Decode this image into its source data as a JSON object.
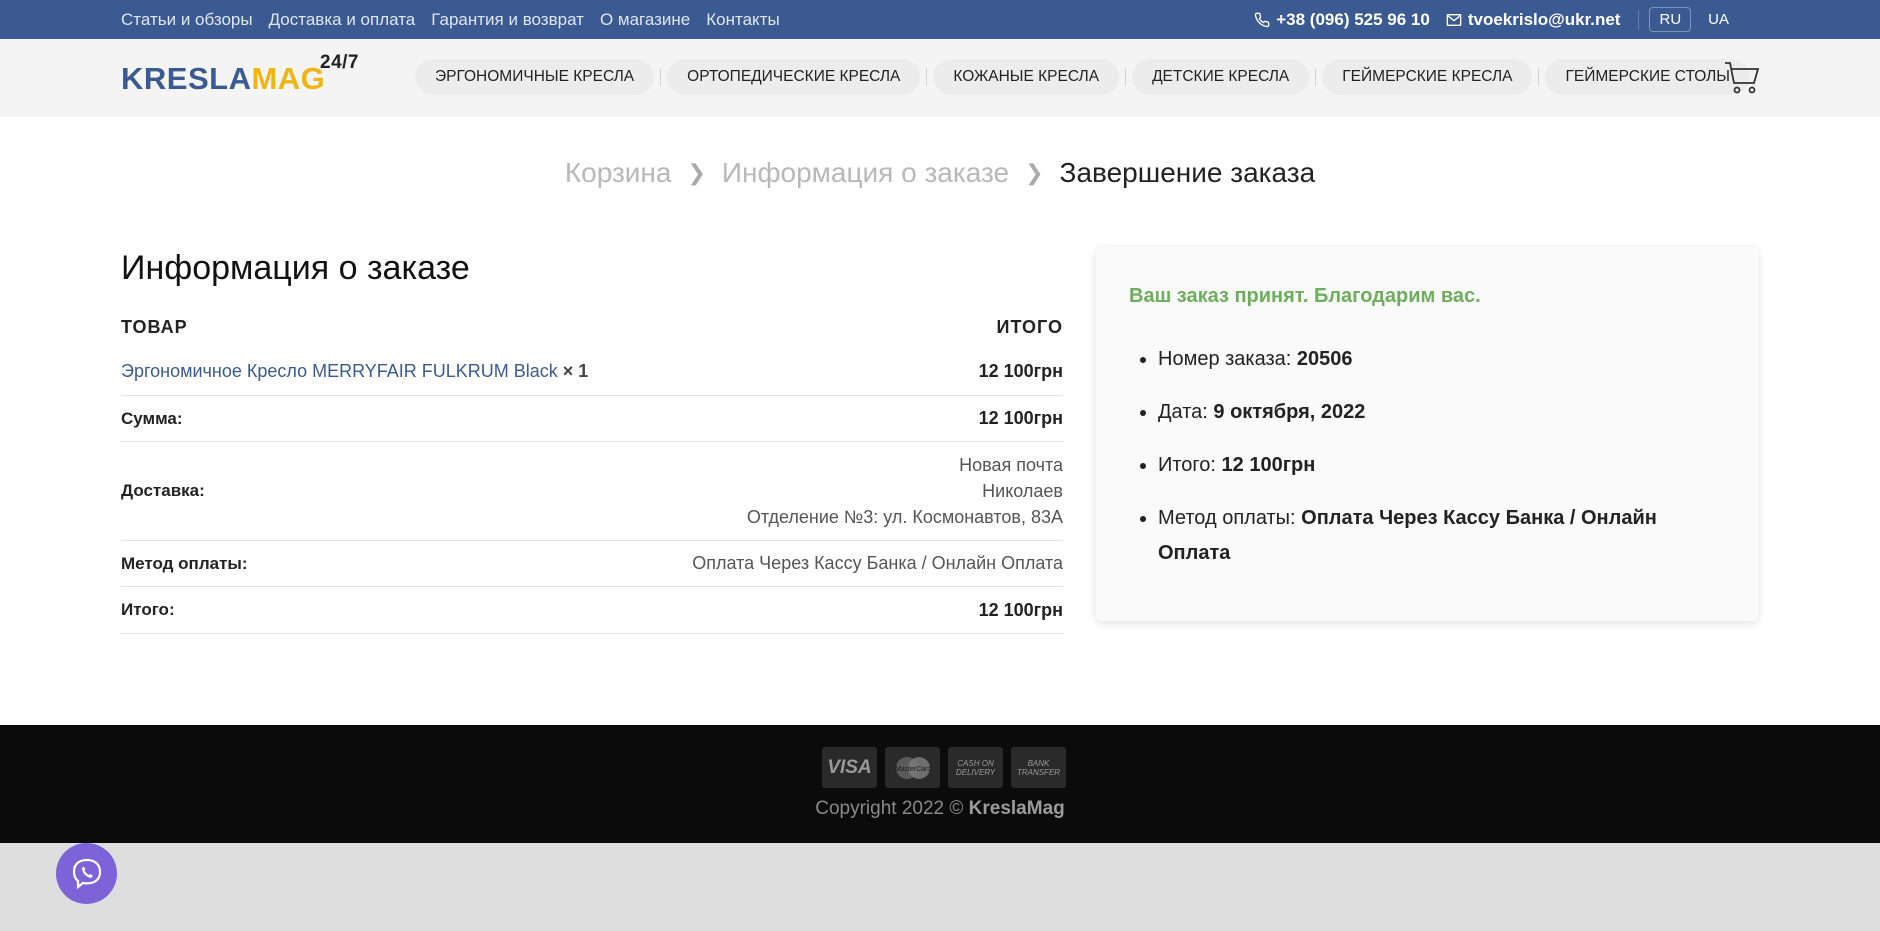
{
  "topbar": {
    "links": [
      "Статьи и обзоры",
      "Доставка и оплата",
      "Гарантия и возврат",
      "О магазине",
      "Контакты"
    ],
    "phone": "+38 (096) 525 96 10",
    "email": "tvoekrislo@ukr.net",
    "languages": [
      "RU",
      "UA"
    ],
    "active_language": "RU"
  },
  "header": {
    "logo_part1": "KRESLA",
    "logo_part2": "MAG",
    "logo_sup": "24/7",
    "nav": [
      "Эргономичные кресла",
      "Ортопедические кресла",
      "Кожаные кресла",
      "Детские кресла",
      "Геймерские кресла",
      "Геймерские столы"
    ]
  },
  "breadcrumbs": [
    "Корзина",
    "Информация о заказе",
    "Завершение заказа"
  ],
  "order": {
    "title": "Информация о заказе",
    "col_product": "ТОВАР",
    "col_total": "ИТОГО",
    "product_name": "Эргономичное Кресло MERRYFAIR FULKRUM Black",
    "product_qty": "× 1",
    "product_price": "12 100грн",
    "subtotal_label": "Сумма:",
    "subtotal_value": "12 100грн",
    "shipping_label": "Доставка:",
    "shipping_lines": [
      "Новая почта",
      "Николаев",
      "Отделение №3: ул. Космонавтов, 83А"
    ],
    "payment_label": "Метод оплаты:",
    "payment_value": "Оплата Через Кассу Банка / Онлайн Оплата",
    "total_label": "Итого:",
    "total_value": "12 100грн"
  },
  "confirmation": {
    "thanks": "Ваш заказ принят. Благодарим вас.",
    "number_label": "Номер заказа:",
    "number_value": "20506",
    "date_label": "Дата:",
    "date_value": "9 октября, 2022",
    "total_label": "Итого:",
    "total_value": "12 100грн",
    "payment_label": "Метод оплаты:",
    "payment_value": "Оплата Через Кассу Банка / Онлайн Оплата"
  },
  "footer": {
    "payment_icons": [
      "VISA",
      "MasterCard",
      "CASH ON DELIVERY",
      "BANK TRANSFER"
    ],
    "copyright_prefix": "Copyright 2022 ©",
    "copyright_brand": "KreslaMag"
  },
  "colors": {
    "topbar": "#3b5a92",
    "logo_blue": "#3b5a92",
    "logo_yellow": "#efb513",
    "success_green": "#6dad5c",
    "viber_purple": "#7d63d8"
  }
}
